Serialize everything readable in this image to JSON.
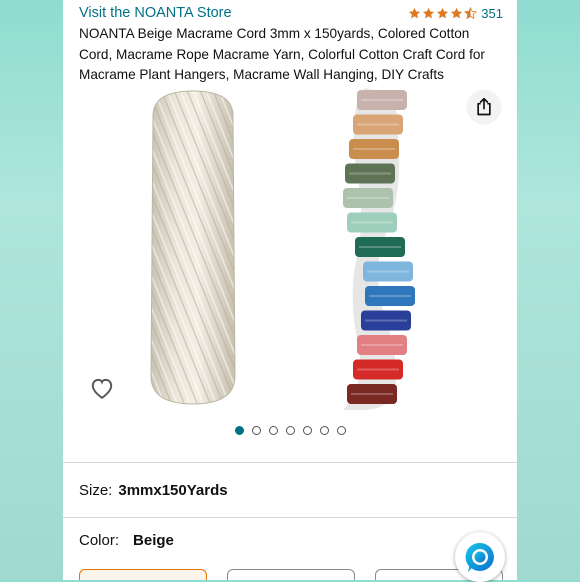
{
  "store": {
    "link_text": "Visit the NOANTA Store",
    "rating_value": 4.5,
    "rating_count": "351",
    "star_color": "#de7921"
  },
  "product": {
    "title": "NOANTA Beige Macrame Cord 3mm x 150yards, Colored Cotton Cord, Macrame Rope Macrame Yarn, Colorful Cotton Craft Cord for Macrame Plant Hangers, Macrame Wall Hanging, DIY Crafts",
    "image_subject": "beige macrame cord spool with colored cord spools",
    "spool_colors": [
      "#c8b2ad",
      "#d9a476",
      "#c98d4e",
      "#5f7355",
      "#adc2ad",
      "#9ecfbd",
      "#1f6b56",
      "#7fb6de",
      "#2f76bd",
      "#2a3f9a",
      "#e27f82",
      "#d52b28",
      "#7a2a22"
    ]
  },
  "carousel": {
    "total_images": 7,
    "active_index": 0,
    "active_color": "#007185"
  },
  "size": {
    "label": "Size:",
    "value": "3mmx150Yards"
  },
  "color": {
    "label": "Color:",
    "value": "Beige"
  },
  "icons": {
    "share": "share-icon",
    "wishlist": "heart-icon",
    "assistant": "alexa-icon"
  }
}
